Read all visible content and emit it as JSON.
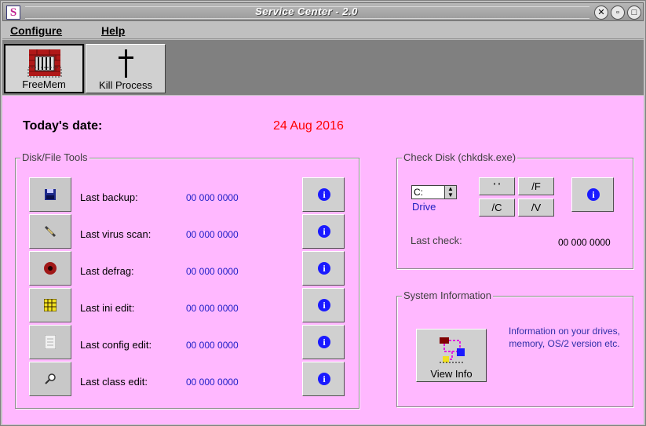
{
  "window": {
    "title": "Service Center - 2.0",
    "sys_icon": "S"
  },
  "menu": {
    "configure": "Configure",
    "help": "Help"
  },
  "toolbar": {
    "freemem": {
      "label": "FreeMem",
      "icon": "brick-wall-icon"
    },
    "kill": {
      "label": "Kill Process",
      "icon": "cross-icon"
    }
  },
  "today": {
    "label": "Today's date:",
    "value": "24 Aug 2016"
  },
  "disk_tools": {
    "title": "Disk/File Tools",
    "rows": [
      {
        "label": "Last backup:",
        "value": "00 000 0000",
        "icon": "floppy-disk-icon"
      },
      {
        "label": "Last virus scan:",
        "value": "00 000 0000",
        "icon": "syringe-icon"
      },
      {
        "label": "Last defrag:",
        "value": "00 000 0000",
        "icon": "disk-target-icon"
      },
      {
        "label": "Last ini edit:",
        "value": "00 000 0000",
        "icon": "grid-file-icon"
      },
      {
        "label": "Last config edit:",
        "value": "00 000 0000",
        "icon": "document-icon"
      },
      {
        "label": "Last class edit:",
        "value": "00 000 0000",
        "icon": "magnifier-icon"
      }
    ],
    "info_glyph": "i"
  },
  "check_disk": {
    "title": "Check Disk (chkdsk.exe)",
    "drive_value": "C:",
    "drive_label": "Drive",
    "buttons": [
      "' '",
      "/F",
      "/C",
      "/V"
    ],
    "last_check_label": "Last check:",
    "last_check_value": "00 000 0000"
  },
  "system_info": {
    "title": "System Information",
    "button_label": "View Info",
    "description": "Information on your drives, memory, OS/2 version etc."
  }
}
